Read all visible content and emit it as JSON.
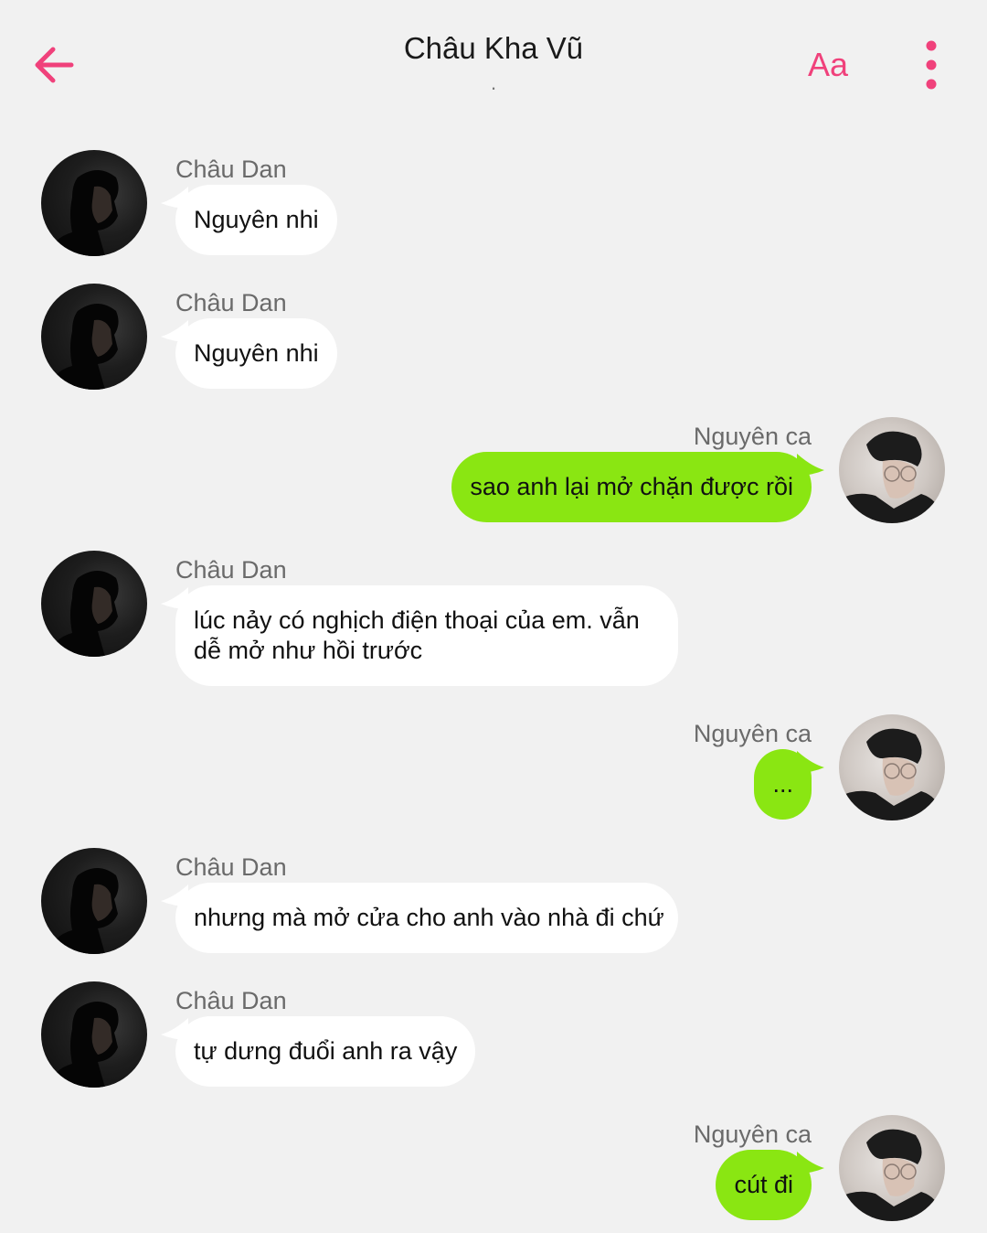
{
  "header": {
    "title": "Châu Kha Vũ",
    "subtitle": ".",
    "font_button_label": "Aa"
  },
  "colors": {
    "accent": "#f0417b",
    "sent_bubble": "#8ae612",
    "received_bubble": "#ffffff",
    "background": "#f1f1f1"
  },
  "icons": {
    "back": "arrow-left-icon",
    "more": "vertical-dots-icon"
  },
  "messages": [
    {
      "side": "left",
      "sender": "Châu Dan",
      "text": "Nguyên nhi"
    },
    {
      "side": "left",
      "sender": "Châu Dan",
      "text": "Nguyên nhi"
    },
    {
      "side": "right",
      "sender": "Nguyên ca",
      "text": "sao anh lại mở chặn được rồi"
    },
    {
      "side": "left",
      "sender": "Châu Dan",
      "text": "lúc nảy có nghịch điện thoại của em. vẫn dễ mở như hồi trước"
    },
    {
      "side": "right",
      "sender": "Nguyên ca",
      "text": "..."
    },
    {
      "side": "left",
      "sender": "Châu Dan",
      "text": "nhưng mà mở cửa cho anh vào nhà đi chứ"
    },
    {
      "side": "left",
      "sender": "Châu Dan",
      "text": "tự dưng đuổi anh ra vậy"
    },
    {
      "side": "right",
      "sender": "Nguyên ca",
      "text": "cút đi"
    }
  ]
}
